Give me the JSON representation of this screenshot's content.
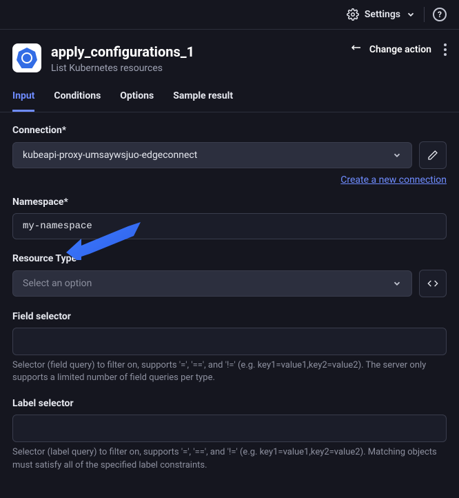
{
  "topbar": {
    "settings_label": "Settings"
  },
  "header": {
    "title": "apply_configurations_1",
    "subtitle": "List Kubernetes resources",
    "change_action_label": "Change action"
  },
  "tabs": {
    "input": "Input",
    "conditions": "Conditions",
    "options": "Options",
    "sample_result": "Sample result",
    "active": "input"
  },
  "form": {
    "connection": {
      "label": "Connection*",
      "value": "kubeapi-proxy-umsaywsjuo-edgeconnect",
      "create_link": "Create a new connection"
    },
    "namespace": {
      "label": "Namespace*",
      "value": "my-namespace"
    },
    "resource_type": {
      "label": "Resource Type*",
      "placeholder": "Select an option"
    },
    "field_selector": {
      "label": "Field selector",
      "value": "",
      "helper": "Selector (field query) to filter on, supports '=', '==', and '!=' (e.g. key1=value1,key2=value2). The server only supports a limited number of field queries per type."
    },
    "label_selector": {
      "label": "Label selector",
      "value": "",
      "helper": "Selector (label query) to filter on, supports '=', '==', and '!=' (e.g. key1=value1,key2=value2). Matching objects must satisfy all of the specified label constraints."
    }
  },
  "annotation": {
    "points_to": "resource_type_label"
  }
}
